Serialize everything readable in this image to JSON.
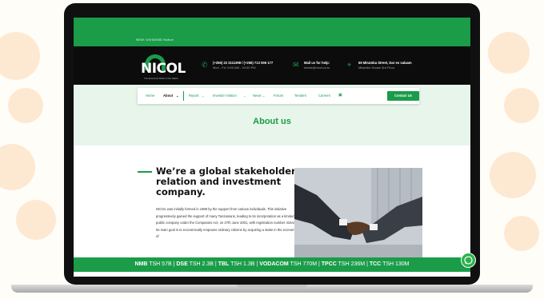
{
  "topbar": {
    "text": "NEW: DIVIDEND Notice"
  },
  "logo": {
    "text": "NICOL",
    "tagline": "The Economic Model of the Nation"
  },
  "header_info": [
    {
      "icon": "phone-icon",
      "line1": "(+255) 22 2111398 / (+255) 713 006 177",
      "line2": "Mon - Fri: 9:00 AM - 04:00 PM"
    },
    {
      "icon": "mail-icon",
      "line1": "Mail us for help:",
      "line2": "invest@nicol.co.tz"
    },
    {
      "icon": "location-icon",
      "line1": "59 Miramba Street, Dar es salaam",
      "line2": "Mkambo House 3rd Floor"
    }
  ],
  "nav": {
    "items": [
      "Home",
      "About",
      "Report",
      "Investor relation",
      "News",
      "Forum",
      "Tenders",
      "Careers"
    ],
    "contact_label": "Contact Us"
  },
  "page": {
    "title": "About us"
  },
  "about": {
    "heading": "We’re a global stakeholder relation and investment company.",
    "paragraph": "NICOL was initially formed in 1999 by the support from various individuals. This initiative progressively gained the support of many Tanzanians, leading to its incorporation as a limited public company under the Companies Act, on 27th June 2001, with registration number 41644. Its main goal is to economically empower ordinary citizens by acquiring a stake in the economy of"
  },
  "ticker": [
    {
      "name": "NMB",
      "value": "TSH 57B"
    },
    {
      "name": "DSE",
      "value": "TSH 2.3B"
    },
    {
      "name": "TBL",
      "value": "TSH 1.3B"
    },
    {
      "name": "VODACOM",
      "value": "TSH 770M"
    },
    {
      "name": "TPCC",
      "value": "TSH 236M"
    },
    {
      "name": "TCC",
      "value": "TSH 130M"
    }
  ],
  "colors": {
    "brand": "#1b9c49",
    "hero_bg": "#e7f5ea",
    "header_bg": "#0c0c0c"
  }
}
